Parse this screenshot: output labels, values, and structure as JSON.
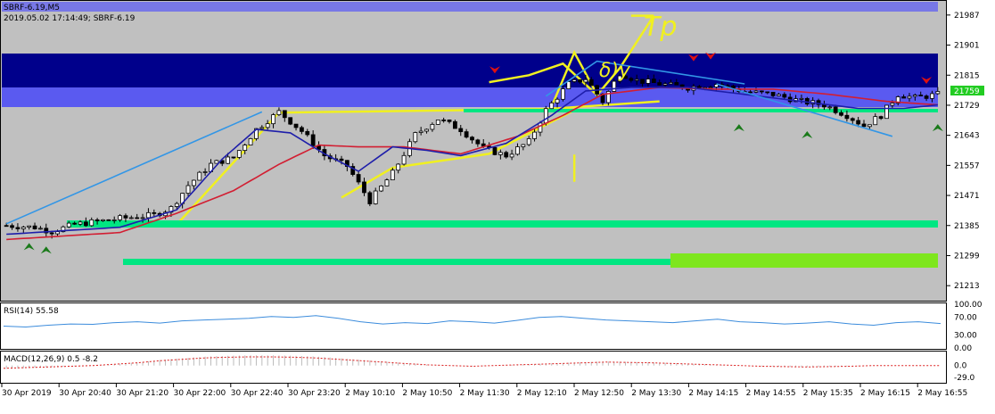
{
  "header": {
    "symbol_line": "SBRF-6.19,M5",
    "info_line": "2019.05.02 17:14:49; SBRF-6.19"
  },
  "price_axis": {
    "ticks": [
      "21987",
      "21901",
      "21815",
      "21729",
      "21643",
      "21557",
      "21471",
      "21385",
      "21299",
      "21213"
    ],
    "current_price": "21759"
  },
  "time_axis": {
    "labels": [
      "30 Apr 2019",
      "30 Apr 20:40",
      "30 Apr 21:20",
      "30 Apr 22:00",
      "30 Apr 22:40",
      "30 Apr 23:20",
      "2 May 10:10",
      "2 May 10:50",
      "2 May 11:30",
      "2 May 12:10",
      "2 May 12:50",
      "2 May 13:30",
      "2 May 14:15",
      "2 May 14:55",
      "2 May 15:35",
      "2 May 16:15",
      "2 May 16:55"
    ]
  },
  "rsi_panel": {
    "label": "RSI(14) 55.58",
    "ticks": [
      "100.00",
      "70.00",
      "30.00",
      "0.00"
    ]
  },
  "macd_panel": {
    "label": "MACD(12,26,9) 0.5 -8.2",
    "ticks": [
      "0.0",
      "-29.0"
    ]
  },
  "annotations": {
    "tp": "Tp",
    "b_mark": "δ)y"
  },
  "colors": {
    "background": "#c0c0c0",
    "band_dark": "#00008b",
    "band_light": "#5a5af0",
    "ma_fast": "#1e1eaa",
    "ma_slow": "#d21e32",
    "support_green": "#00e682",
    "lime": "#7ee61e",
    "yellow": "#f0f020",
    "trendline_blue": "#3296e6",
    "rsi_line": "#3c8cdc",
    "macd_line": "#dc1e1e"
  },
  "chart_data": {
    "type": "candlestick",
    "ylim": [
      21170,
      22030
    ],
    "candles_count": 165,
    "price_path": [
      [
        0,
        21385
      ],
      [
        5,
        21380
      ],
      [
        8,
        21368
      ],
      [
        12,
        21388
      ],
      [
        20,
        21405
      ],
      [
        26,
        21415
      ],
      [
        29,
        21435
      ],
      [
        32,
        21500
      ],
      [
        36,
        21560
      ],
      [
        40,
        21580
      ],
      [
        44,
        21660
      ],
      [
        48,
        21710
      ],
      [
        52,
        21655
      ],
      [
        56,
        21585
      ],
      [
        60,
        21555
      ],
      [
        64,
        21455
      ],
      [
        68,
        21535
      ],
      [
        72,
        21645
      ],
      [
        76,
        21690
      ],
      [
        80,
        21660
      ],
      [
        84,
        21605
      ],
      [
        88,
        21585
      ],
      [
        92,
        21625
      ],
      [
        95,
        21715
      ],
      [
        99,
        21790
      ],
      [
        102,
        21805
      ],
      [
        105,
        21740
      ],
      [
        108,
        21822
      ],
      [
        111,
        21800
      ],
      [
        115,
        21790
      ],
      [
        120,
        21780
      ],
      [
        125,
        21790
      ],
      [
        130,
        21768
      ],
      [
        135,
        21760
      ],
      [
        140,
        21740
      ],
      [
        144,
        21730
      ],
      [
        148,
        21700
      ],
      [
        151,
        21670
      ],
      [
        154,
        21700
      ],
      [
        157,
        21760
      ],
      [
        160,
        21750
      ],
      [
        164,
        21760
      ]
    ],
    "ma_fast": [
      [
        0,
        21360
      ],
      [
        20,
        21380
      ],
      [
        30,
        21430
      ],
      [
        38,
        21575
      ],
      [
        44,
        21660
      ],
      [
        50,
        21650
      ],
      [
        56,
        21590
      ],
      [
        62,
        21540
      ],
      [
        68,
        21610
      ],
      [
        74,
        21600
      ],
      [
        80,
        21585
      ],
      [
        88,
        21620
      ],
      [
        96,
        21700
      ],
      [
        102,
        21770
      ],
      [
        110,
        21780
      ],
      [
        120,
        21780
      ],
      [
        130,
        21760
      ],
      [
        140,
        21740
      ],
      [
        150,
        21720
      ],
      [
        158,
        21720
      ],
      [
        164,
        21730
      ]
    ],
    "ma_slow": [
      [
        0,
        21345
      ],
      [
        20,
        21365
      ],
      [
        30,
        21420
      ],
      [
        40,
        21485
      ],
      [
        48,
        21560
      ],
      [
        55,
        21615
      ],
      [
        62,
        21610
      ],
      [
        70,
        21610
      ],
      [
        80,
        21590
      ],
      [
        90,
        21640
      ],
      [
        98,
        21700
      ],
      [
        105,
        21760
      ],
      [
        115,
        21780
      ],
      [
        125,
        21775
      ],
      [
        135,
        21775
      ],
      [
        145,
        21760
      ],
      [
        155,
        21740
      ],
      [
        164,
        21730
      ]
    ],
    "rsi": {
      "ylim": [
        0,
        100
      ],
      "values": [
        50,
        48,
        52,
        55,
        54,
        58,
        60,
        57,
        62,
        64,
        66,
        68,
        72,
        70,
        74,
        68,
        60,
        55,
        58,
        56,
        62,
        60,
        57,
        63,
        70,
        72,
        68,
        64,
        62,
        60,
        58,
        62,
        66,
        60,
        58,
        55,
        57,
        60,
        55,
        52,
        58,
        60,
        56
      ]
    },
    "macd": {
      "ylim": [
        -40,
        30
      ],
      "values": [
        -8,
        -6,
        -4,
        -2,
        0,
        4,
        8,
        14,
        18,
        22,
        24,
        25,
        25,
        24,
        22,
        18,
        14,
        10,
        6,
        2,
        0,
        -2,
        0,
        2,
        4,
        6,
        8,
        10,
        9,
        8,
        6,
        4,
        2,
        0,
        -2,
        -3,
        -4,
        -3,
        -2,
        0,
        0,
        0,
        0
      ]
    },
    "levels": {
      "support_upper": 21345,
      "support_lower": 21250,
      "band_top": 21865,
      "band_mid": 21775,
      "band_bottom": 21710
    }
  }
}
